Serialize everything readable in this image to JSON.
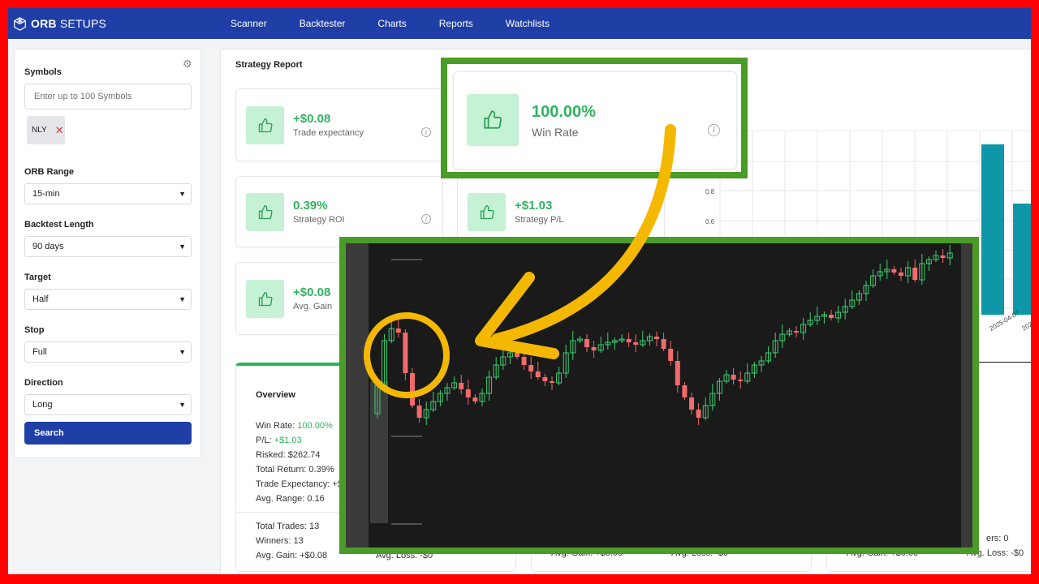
{
  "app": {
    "brand": "ORB",
    "brand_suffix": "SETUPS"
  },
  "nav": {
    "items": [
      "Scanner",
      "Backtester",
      "Charts",
      "Reports",
      "Watchlists"
    ]
  },
  "sidebar": {
    "symbols_label": "Symbols",
    "symbols_placeholder": "Enter up to 100 Symbols",
    "chip": "NLY",
    "orb_range_label": "ORB Range",
    "orb_range_value": "15-min",
    "backtest_length_label": "Backtest Length",
    "backtest_length_value": "90 days",
    "target_label": "Target",
    "target_value": "Half",
    "stop_label": "Stop",
    "stop_value": "Full",
    "direction_label": "Direction",
    "direction_value": "Long",
    "search_label": "Search"
  },
  "report": {
    "title": "Strategy Report",
    "cards": {
      "expectancy": {
        "value": "+$0.08",
        "label": "Trade expectancy"
      },
      "win_rate": {
        "value": "100.00%",
        "label": "Win Rate"
      },
      "roi": {
        "value": "0.39%",
        "label": "Strategy ROI"
      },
      "pl": {
        "value": "+$1.03",
        "label": "Strategy P/L"
      },
      "avg_gain": {
        "value": "+$0.08",
        "label": "Avg. Gain"
      }
    },
    "chart": {
      "yticks": [
        "0.8",
        "0.6"
      ],
      "xticks": [
        "2025-04-07",
        "2025-"
      ],
      "bar_color": "#0e97a6"
    },
    "overview": {
      "title": "Overview",
      "win_rate_label": "Win Rate:",
      "win_rate": "100.00%",
      "pl_label": "P/L:",
      "pl": "+$1.03",
      "risked": "Risked: $262.74",
      "total_return": "Total Return: 0.39%",
      "trade_expectancy": "Trade Expectancy: +$",
      "avg_range": "Avg. Range: 0.16",
      "total_trades": "Total Trades: 13",
      "winners": "Winners: 13",
      "avg_gain": "Avg. Gain: +$0.08",
      "avg_loss_partial": "Avg. Loss: -$0"
    },
    "card2_partial": {
      "line1": "Avg. Gain: +$0.00",
      "line2": "Avg. Loss: -$0"
    },
    "card3_partial": {
      "winners": "ers: 0",
      "avg_gain": "Avg. Gain: +$0.00",
      "avg_loss": "Avg. Loss: -$0"
    }
  },
  "colors": {
    "nav": "#1f3fa6",
    "accent_green": "#2fb35f",
    "callout_border": "#4a9b27",
    "arrow": "#f5b800",
    "candle_up": "#3ecf72",
    "candle_down": "#f06b6b"
  },
  "icons": {
    "thumb": "thumbs-up-icon",
    "gear": "gear-icon",
    "info": "info-icon",
    "close": "close-icon",
    "chev": "chevron-down-icon"
  }
}
